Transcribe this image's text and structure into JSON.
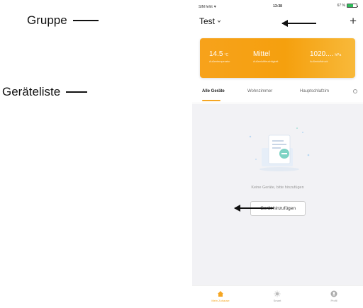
{
  "annotations": {
    "group_label": "Gruppe",
    "list_label": "Geräteliste"
  },
  "status_bar": {
    "carrier": "SIM fehlt",
    "time": "13:38",
    "battery": "67 %"
  },
  "header": {
    "group_name": "Test"
  },
  "weather": {
    "temperature": {
      "value": "14.5",
      "unit": "°C",
      "label": "Außentemperatur"
    },
    "humidity": {
      "value": "Mittel",
      "label": "Außenluftfeuchtigkeit"
    },
    "pressure": {
      "value": "1020....",
      "unit": "hPa",
      "label": "Außenluftdruck"
    }
  },
  "tabs": [
    {
      "label": "Alle Geräte",
      "active": true
    },
    {
      "label": "Wohnzimmer",
      "active": false
    },
    {
      "label": "Hauptschlafzim",
      "active": false
    }
  ],
  "empty_state": {
    "message": "Keine Geräte, bitte hinzufügen",
    "button_label": "Gerät hinzufügen"
  },
  "bottom_nav": [
    {
      "label": "Mein Zuhause",
      "icon": "home-icon",
      "active": true
    },
    {
      "label": "Smart",
      "icon": "smart-icon",
      "active": false
    },
    {
      "label": "Profil",
      "icon": "profile-icon",
      "active": false
    }
  ],
  "colors": {
    "accent": "#f5a623",
    "card_gradient_start": "#f7a21b",
    "card_gradient_end": "#f8b93a"
  }
}
